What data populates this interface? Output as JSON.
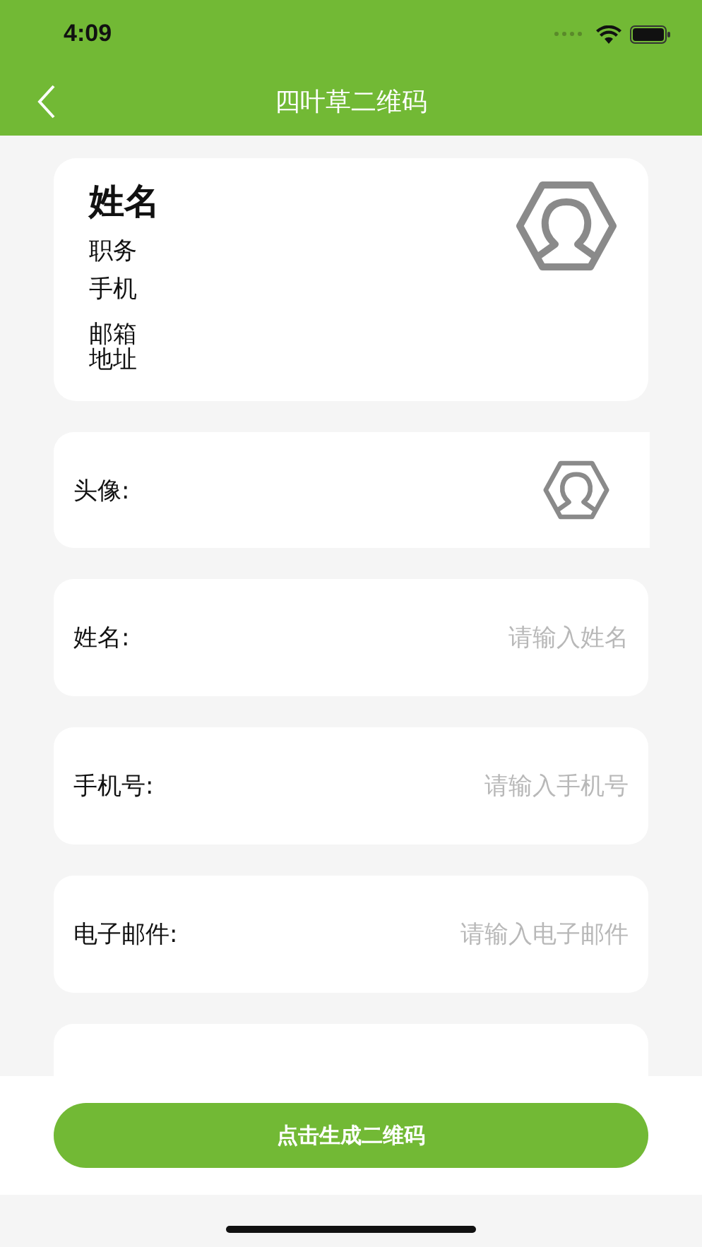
{
  "status_bar": {
    "time": "4:09"
  },
  "nav": {
    "title": "四叶草二维码"
  },
  "preview": {
    "name": "姓名",
    "lines": [
      "职务",
      "手机",
      "邮箱",
      "地址"
    ]
  },
  "form": [
    {
      "kind": "avatar",
      "label": "头像:"
    },
    {
      "kind": "input",
      "label": "姓名:",
      "placeholder": "请输入姓名"
    },
    {
      "kind": "input",
      "label": "手机号:",
      "placeholder": "请输入手机号"
    },
    {
      "kind": "input",
      "label": "电子邮件:",
      "placeholder": "请输入电子邮件"
    },
    {
      "kind": "blank"
    }
  ],
  "button": "点击生成二维码"
}
